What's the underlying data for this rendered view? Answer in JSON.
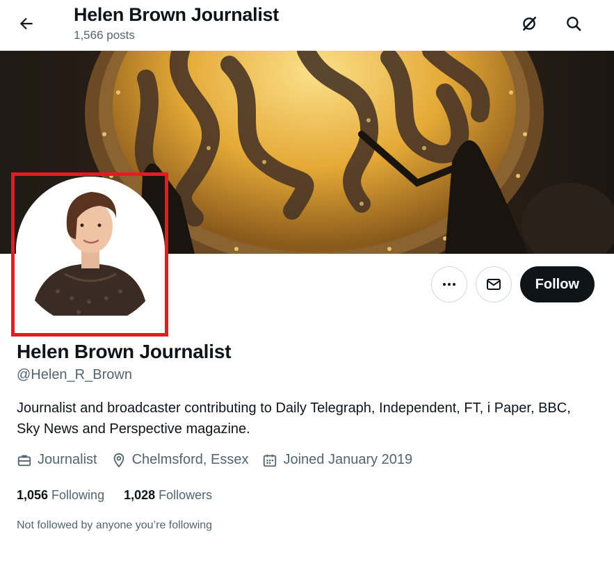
{
  "header": {
    "title": "Helen Brown Journalist",
    "post_count": "1,566 posts"
  },
  "icons": {
    "back": "arrow-left-icon",
    "grok": "grok-icon",
    "search": "search-icon",
    "more": "more-icon",
    "message": "envelope-icon"
  },
  "profile": {
    "name": "Helen Brown Journalist",
    "handle": "@Helen_R_Brown",
    "bio": "Journalist and broadcaster contributing to Daily Telegraph, Independent, FT, i Paper, BBC, Sky News and Perspective magazine.",
    "profession": "Journalist",
    "location": "Chelmsford, Essex",
    "joined": "Joined January 2019",
    "following_count": "1,056",
    "following_label": "Following",
    "followers_count": "1,028",
    "followers_label": "Followers",
    "mutuals_note": "Not followed by anyone you’re following"
  },
  "actions": {
    "follow_label": "Follow"
  },
  "colors": {
    "highlight_border": "#e31b23",
    "follow_bg": "#0f1419",
    "secondary_text": "#536471",
    "banner_glow": "#f5c24a"
  }
}
